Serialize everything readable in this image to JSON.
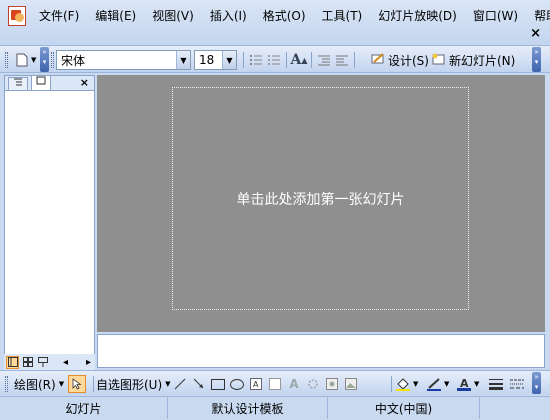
{
  "menu": {
    "items": [
      "文件(F)",
      "编辑(E)",
      "视图(V)",
      "插入(I)",
      "格式(O)",
      "工具(T)",
      "幻灯片放映(D)",
      "窗口(W)",
      "帮助(H)"
    ],
    "close_glyph": "×"
  },
  "toolbar": {
    "font_name": "宋体",
    "font_size": "18",
    "design_label": "设计(S)",
    "new_slide_label": "新幻灯片(N)"
  },
  "outline_pane": {
    "close_glyph": "×"
  },
  "slide": {
    "placeholder_text": "单击此处添加第一张幻灯片",
    "background_color": "#8f8f8f"
  },
  "drawbar": {
    "draw_label": "绘图(R)",
    "autoshapes_label": "自选图形(U)"
  },
  "status": {
    "slide_label": "幻灯片",
    "template_label": "默认设计模板",
    "language_label": "中文(中国)"
  }
}
